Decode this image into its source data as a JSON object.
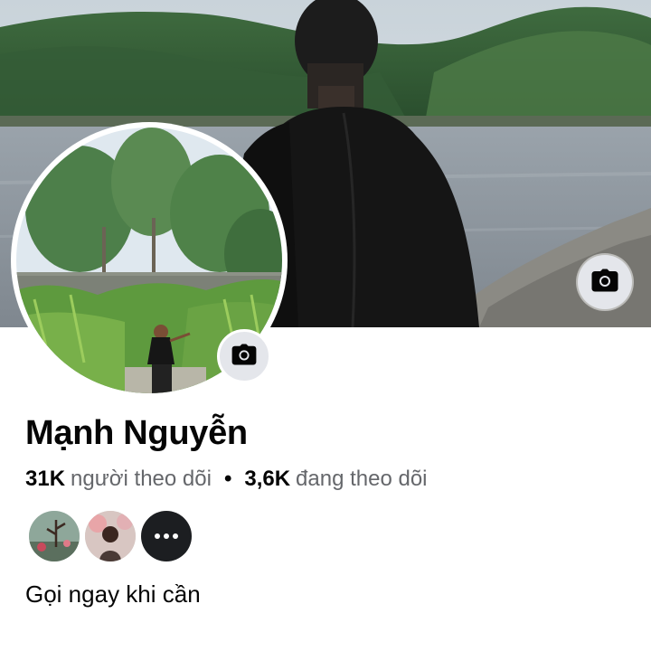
{
  "profile": {
    "name": "Mạnh Nguyễn",
    "bio": "Gọi ngay khi cần"
  },
  "stats": {
    "followers_count": "31K",
    "followers_label": "người theo dõi",
    "separator": "•",
    "following_count": "3,6K",
    "following_label": "đang theo dõi"
  },
  "icons": {
    "cover_camera": "camera-icon",
    "avatar_camera": "camera-icon",
    "more": "more-dots-icon"
  },
  "colors": {
    "secondary_text": "#65676b",
    "primary_text": "#050505",
    "button_bg": "#e4e6eb"
  }
}
